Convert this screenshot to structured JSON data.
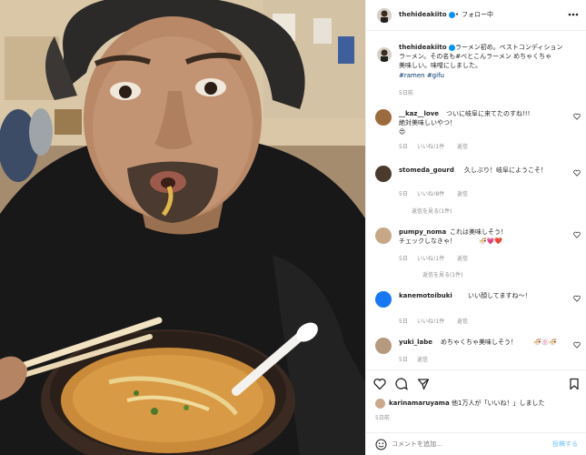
{
  "post": {
    "author": "thehideakiito",
    "follow_label": "フォロー中",
    "dot": "•",
    "caption_lines": [
      "ラーメン初め。ベストコンディション",
      "ラーメン。その名も#べとこんラーメン めちゃくちゃ",
      "美味しい。味噌にしました。"
    ],
    "caption_hashtags": "#ramen #gifu",
    "time": "5日前"
  },
  "comments": [
    {
      "user": "__kaz__love",
      "lines": [
        "ついに岐阜に来てたのすね!!!",
        "絶対美味しいやつ！"
      ],
      "emoji": "😍",
      "meta_time": "5日",
      "meta_likes": "いいね!1件",
      "meta_reply": "返信"
    },
    {
      "user": "stomeda_gourd",
      "lines": [
        "久しぶり！岐阜にようこそ！"
      ],
      "emoji": "",
      "meta_time": "5日",
      "meta_likes": "いいね!8件",
      "meta_reply": "返信",
      "view_replies": "返信を見る(1件)"
    },
    {
      "user": "pumpy_noma",
      "lines": [
        "これは美味しそう！",
        "チェックしなきゃ！"
      ],
      "emoji": "🍜💗❤️",
      "meta_time": "5日",
      "meta_likes": "いいね!1件",
      "meta_reply": "返信",
      "view_replies": "返信を見る(1件)"
    },
    {
      "user": "kanemotoibuki",
      "lines": [
        "いい顔してますね〜！"
      ],
      "emoji": "",
      "meta_time": "5日",
      "meta_likes": "いいね!1件",
      "meta_reply": "返信"
    },
    {
      "user": "yuki_labe",
      "lines": [
        "めちゃくちゃ美味しそう！"
      ],
      "emoji": "🍜🍥🍜",
      "meta_time": "5日",
      "meta_likes": "",
      "meta_reply": "返信"
    }
  ],
  "likes": {
    "user": "karinamaruyama",
    "text": "、他1万人が「いいね！」しました",
    "date": "5日前"
  },
  "footer": {
    "emoji_icon": "smiley-icon",
    "placeholder": "コメントを追加...",
    "post_label": "投稿する"
  },
  "icons": {
    "more": "more-icon",
    "heart": "heart-icon",
    "comment": "comment-icon",
    "share": "share-icon",
    "save": "bookmark-icon"
  }
}
